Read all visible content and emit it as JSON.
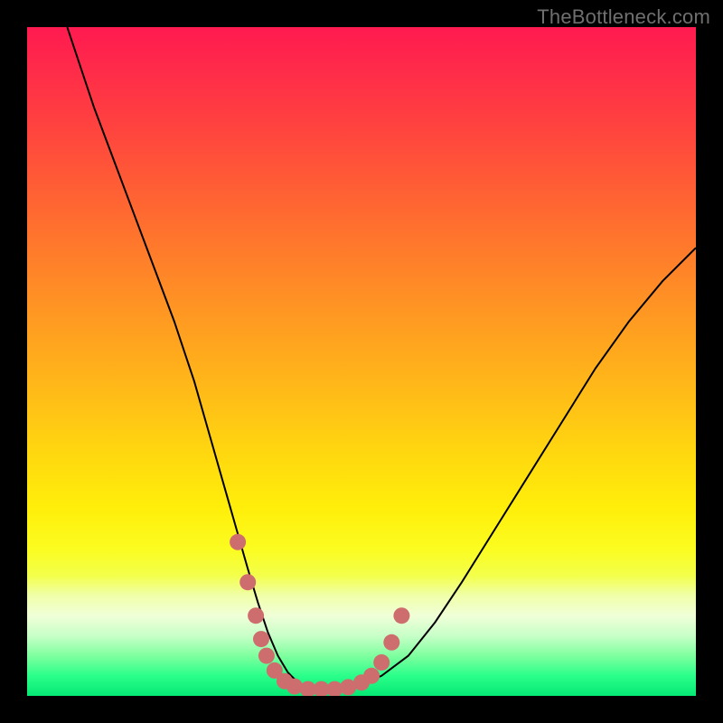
{
  "watermark": "TheBottleneck.com",
  "chart_data": {
    "type": "line",
    "title": "",
    "xlabel": "",
    "ylabel": "",
    "xlim": [
      0,
      100
    ],
    "ylim": [
      0,
      100
    ],
    "series": [
      {
        "name": "bottleneck-curve",
        "x": [
          6,
          8,
          10,
          13,
          16,
          19,
          22,
          25,
          27,
          29,
          31,
          33,
          34.5,
          36,
          37.5,
          39,
          40.5,
          42,
          44,
          46,
          49,
          53,
          57,
          61,
          65,
          70,
          75,
          80,
          85,
          90,
          95,
          100
        ],
        "y": [
          100,
          94,
          88,
          80,
          72,
          64,
          56,
          47,
          40,
          33,
          26,
          19,
          14,
          9.5,
          6,
          3.5,
          2,
          1.3,
          1,
          1,
          1.4,
          3,
          6,
          11,
          17,
          25,
          33,
          41,
          49,
          56,
          62,
          67
        ]
      }
    ],
    "markers": {
      "name": "highlighted-points",
      "points": [
        {
          "x": 31.5,
          "y": 23
        },
        {
          "x": 33.0,
          "y": 17
        },
        {
          "x": 34.2,
          "y": 12
        },
        {
          "x": 35.0,
          "y": 8.5
        },
        {
          "x": 35.8,
          "y": 6
        },
        {
          "x": 37.0,
          "y": 3.8
        },
        {
          "x": 38.5,
          "y": 2.2
        },
        {
          "x": 40.0,
          "y": 1.4
        },
        {
          "x": 42.0,
          "y": 1.0
        },
        {
          "x": 44.0,
          "y": 1.0
        },
        {
          "x": 46.0,
          "y": 1.0
        },
        {
          "x": 48.0,
          "y": 1.3
        },
        {
          "x": 50.0,
          "y": 2.0
        },
        {
          "x": 51.5,
          "y": 3.0
        },
        {
          "x": 53.0,
          "y": 5.0
        },
        {
          "x": 54.5,
          "y": 8.0
        },
        {
          "x": 56.0,
          "y": 12.0
        }
      ],
      "color": "#ce6d6d",
      "radius": 9
    },
    "gradient_stops": [
      {
        "pos": 0,
        "color": "#ff1a50"
      },
      {
        "pos": 50,
        "color": "#ffc015"
      },
      {
        "pos": 78,
        "color": "#fbfc20"
      },
      {
        "pos": 100,
        "color": "#05e874"
      }
    ]
  }
}
